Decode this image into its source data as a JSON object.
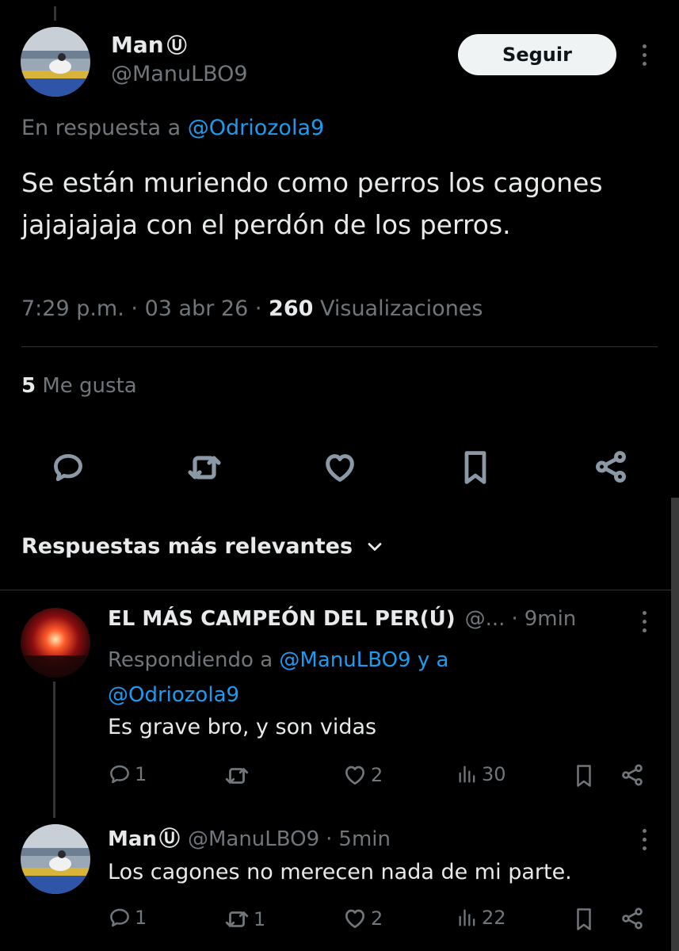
{
  "main_tweet": {
    "author_name": "Man",
    "author_badge": "Ⓤ",
    "author_handle": "@ManuLBO9",
    "follow_label": "Seguir",
    "reply_prefix": "En respuesta a",
    "reply_to": "@Odriozola9",
    "text": "Se están muriendo como perros los cagones jajajajaja con el perdón de los perros.",
    "time": "7:29 p.m.",
    "date": "03 abr 26",
    "views_count": "260",
    "views_label": "Visualizaciones",
    "likes_count": "5",
    "likes_label": "Me gusta",
    "icons": [
      "reply-icon",
      "retweet-icon",
      "like-icon",
      "bookmark-icon",
      "share-icon"
    ]
  },
  "replies_header": {
    "label": "Respuestas más relevantes"
  },
  "replies": [
    {
      "author_name": "EL MÁS CAMPEÓN DEL PER(Ú)",
      "author_handle": "@...",
      "time": "9min",
      "replying_prefix": "Respondiendo a",
      "replying_to_1": "@ManuLBO9",
      "replying_and": "y a",
      "replying_to_2": "@Odriozola9",
      "text": "Es grave bro, y son vidas",
      "reply_count": "1",
      "retweet_count": "",
      "like_count": "2",
      "views_count": "30"
    },
    {
      "author_name": "Man",
      "author_badge": "Ⓤ",
      "author_handle": "@ManuLBO9",
      "time": "5min",
      "text": "Los cagones no merecen nada de mi parte.",
      "reply_count": "1",
      "retweet_count": "1",
      "like_count": "2",
      "views_count": "22"
    }
  ],
  "colors": {
    "background": "#000000",
    "text": "#e7e9ea",
    "muted": "#71767b",
    "link": "#1d9bf0"
  }
}
